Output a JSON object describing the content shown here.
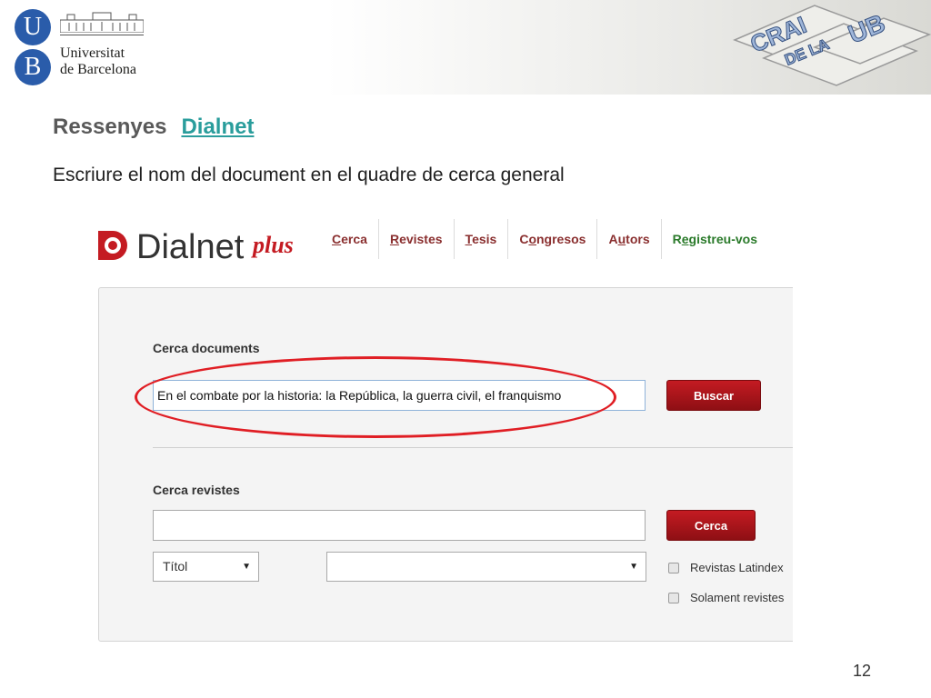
{
  "header": {
    "ub_logo": {
      "letter_top": "U",
      "letter_bottom": "B",
      "name_line1": "Universitat",
      "name_line2": "de Barcelona"
    },
    "crai_logo": {
      "line1": "CRAI",
      "line2": "DE LA",
      "line3": "UB"
    }
  },
  "slide": {
    "title": "Ressenyes",
    "title_link": "Dialnet",
    "subtitle": "Escriure el nom del document en el quadre de cerca general",
    "page_number": "12"
  },
  "dialnet": {
    "logo_text": "Dialnet",
    "logo_suffix": "plus",
    "nav": [
      {
        "pre": "",
        "key": "C",
        "post": "erca"
      },
      {
        "pre": "",
        "key": "R",
        "post": "evistes"
      },
      {
        "pre": "",
        "key": "T",
        "post": "esis"
      },
      {
        "pre": "C",
        "key": "o",
        "post": "ngresos"
      },
      {
        "pre": "A",
        "key": "u",
        "post": "tors"
      },
      {
        "pre": "R",
        "key": "e",
        "post": "gistreu-vos"
      }
    ],
    "docs_label": "Cerca documents",
    "docs_query": "En el combate por la historia: la República, la guerra civil, el franquismo",
    "buscar_label": "Buscar",
    "revs_label": "Cerca revistes",
    "revs_query": "",
    "cerca_label": "Cerca",
    "field_select": "Títol",
    "second_select": "",
    "check_latindex": "Revistas Latindex",
    "check_solament": "Solament revistes"
  },
  "colors": {
    "accent_red": "#c41b22",
    "highlight_red": "#e01e24",
    "link_teal": "#2a9d9c",
    "ub_blue": "#2a5caa",
    "nav_text": "#8a2f2f",
    "nav_register": "#2a7a2a"
  }
}
